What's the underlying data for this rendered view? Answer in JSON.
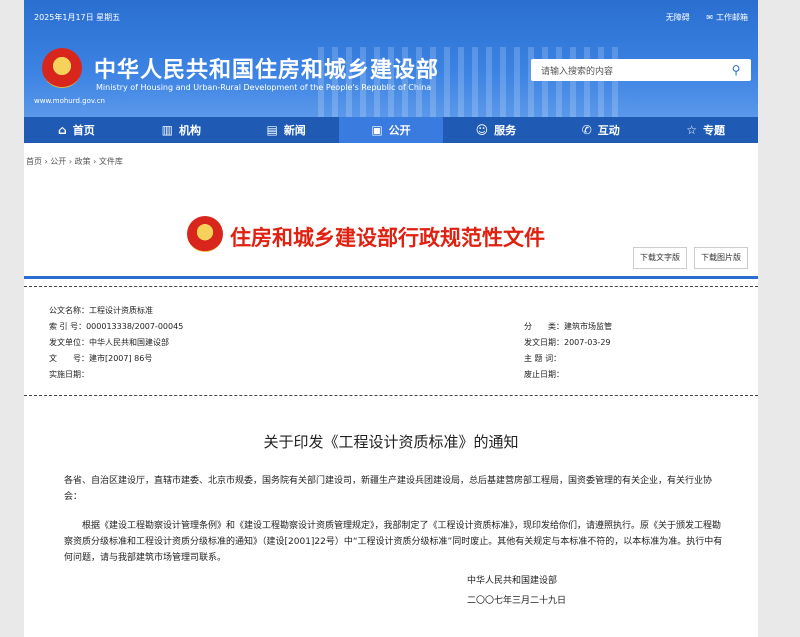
{
  "header": {
    "date": "2025年1月17日 星期五",
    "accessible": "无障碍",
    "mail": "工作邮箱",
    "title_cn": "中华人民共和国住房和城乡建设部",
    "title_en": "Ministry of Housing and Urban-Rural Development of the People's Republic of China",
    "url": "www.mohurd.gov.cn",
    "search_placeholder": "请输入搜索的内容"
  },
  "nav": [
    {
      "label": "首页",
      "icon": "home-icon"
    },
    {
      "label": "机构",
      "icon": "building-icon"
    },
    {
      "label": "新闻",
      "icon": "news-icon"
    },
    {
      "label": "公开",
      "icon": "open-icon"
    },
    {
      "label": "服务",
      "icon": "service-icon"
    },
    {
      "label": "互动",
      "icon": "chat-icon"
    },
    {
      "label": "专题",
      "icon": "star-icon"
    }
  ],
  "breadcrumb": "首页 › 公开 › 政策 › 文件库",
  "banner": {
    "title": "住房和城乡建设部行政规范性文件",
    "download_text": "下载文字版",
    "download_image": "下载图片版"
  },
  "meta": {
    "name_label": "公文名称：",
    "name": "工程设计资质标准",
    "index_label": "索 引 号：",
    "index": "000013338/2007-00045",
    "category_label": "分　　类：",
    "category": "建筑市场监管",
    "issuer_label": "发文单位：",
    "issuer": "中华人民共和国建设部",
    "issue_date_label": "发文日期：",
    "issue_date": "2007-03-29",
    "doc_no_label": "文　　号：",
    "doc_no": "建市[2007] 86号",
    "subject_label": "主 题 词：",
    "subject": "",
    "effective_label": "实施日期：",
    "effective": "",
    "repeal_label": "废止日期：",
    "repeal": ""
  },
  "doc": {
    "title": "关于印发《工程设计资质标准》的通知",
    "recipients": "各省、自治区建设厅，直辖市建委、北京市规委，国务院有关部门建设司，新疆生产建设兵团建设局，总后基建营房部工程局，国资委管理的有关企业，有关行业协会：",
    "body": "根据《建设工程勘察设计管理条例》和《建设工程勘察设计资质管理规定》，我部制定了《工程设计资质标准》，现印发给你们，请遵照执行。原《关于颁发工程勘察资质分级标准和工程设计资质分级标准的通知》（建设[2001]22号）中“工程设计资质分级标准”同时废止。其他有关规定与本标准不符的，以本标准为准。执行中有何问题，请与我部建筑市场管理司联系。",
    "signer": "中华人民共和国建设部",
    "sign_date": "二〇〇七年三月二十九日"
  }
}
